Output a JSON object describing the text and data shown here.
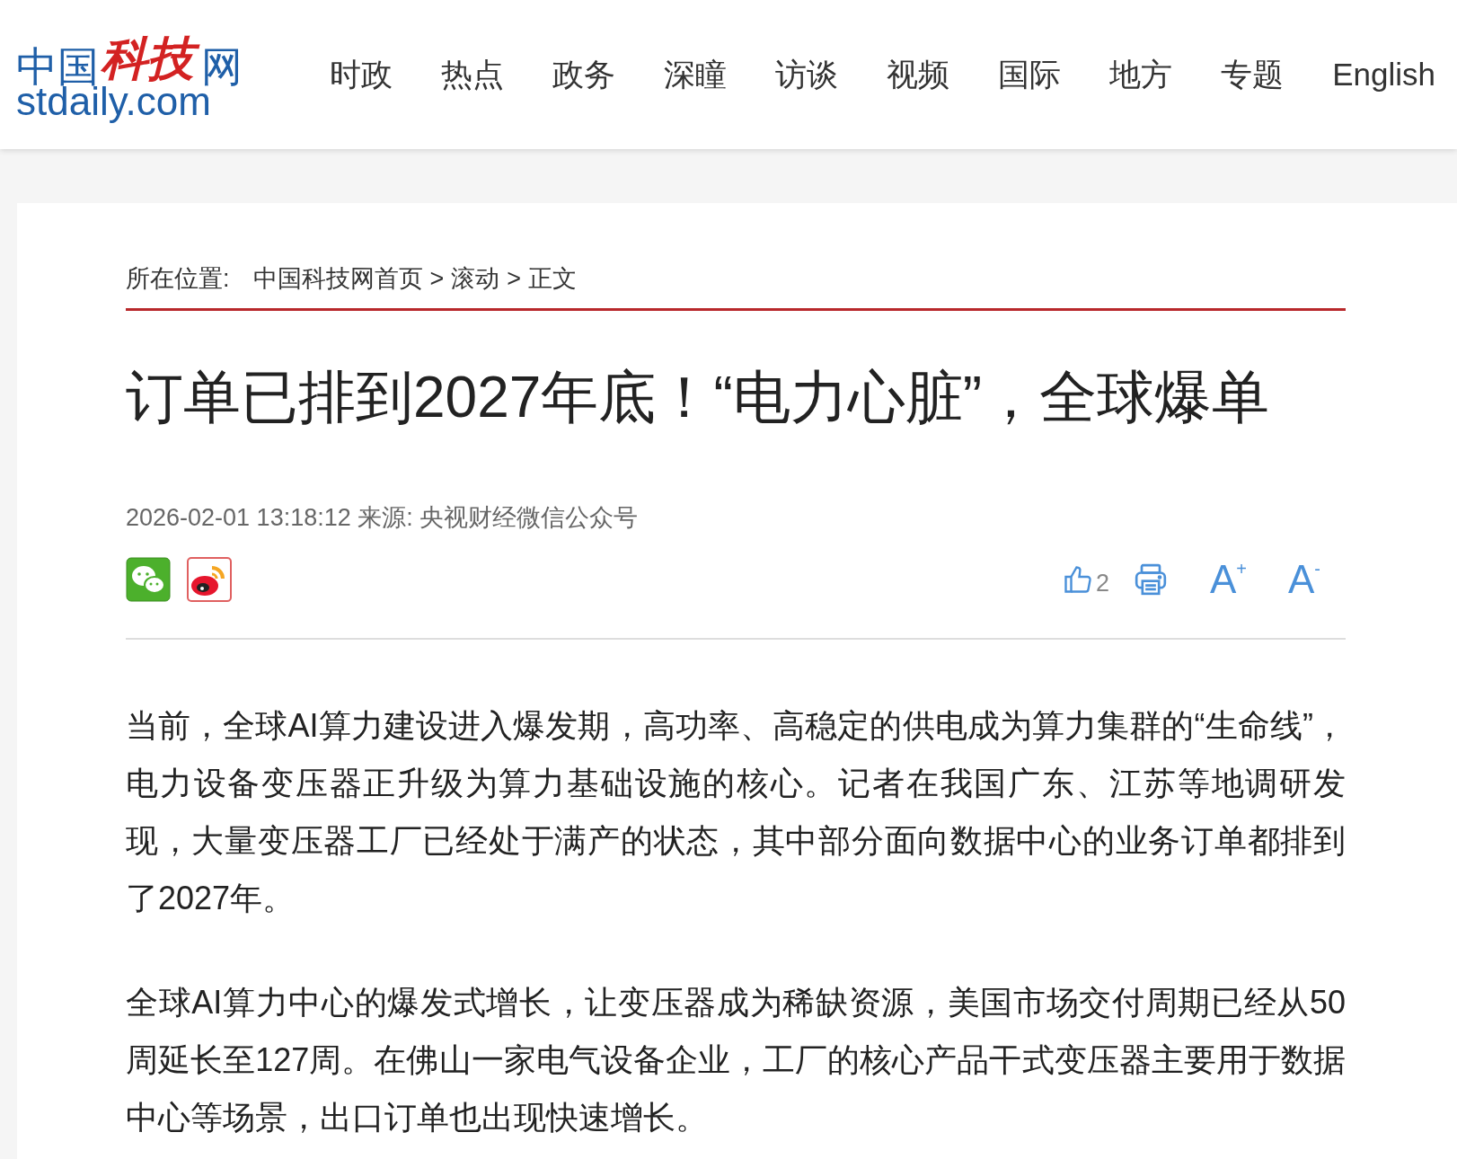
{
  "logo": {
    "name_left": "中国",
    "name_accent": "科技",
    "name_right": "网",
    "domain": "stdaily.com"
  },
  "nav": [
    "时政",
    "热点",
    "政务",
    "深瞳",
    "访谈",
    "视频",
    "国际",
    "地方",
    "专题",
    "English"
  ],
  "breadcrumb": {
    "label": "所在位置:",
    "links": [
      "中国科技网首页",
      "滚动",
      "正文"
    ],
    "separator": ">"
  },
  "article": {
    "title": "订单已排到2027年底！“电力心脏”，全球爆单",
    "meta": "2026-02-01 13:18:12 来源: 央视财经微信公众号",
    "likes": "2",
    "font_controls": [
      {
        "label": "A",
        "sign": "+"
      },
      {
        "label": "A",
        "sign": "-"
      }
    ],
    "paragraphs": [
      "当前，全球AI算力建设进入爆发期，高功率、高稳定的供电成为算力集群的“生命线”，电力设备变压器正升级为算力基础设施的核心。记者在我国广东、江苏等地调研发现，大量变压器工厂已经处于满产的状态，其中部分面向数据中心的业务订单都排到了2027年。",
      "全球AI算力中心的爆发式增长，让变压器成为稀缺资源，美国市场交付周期已经从50周延长至127周。在佛山一家电气设备企业，工厂的核心产品干式变压器主要用于数据中心等场景，出口订单也出现快速增长。"
    ]
  }
}
